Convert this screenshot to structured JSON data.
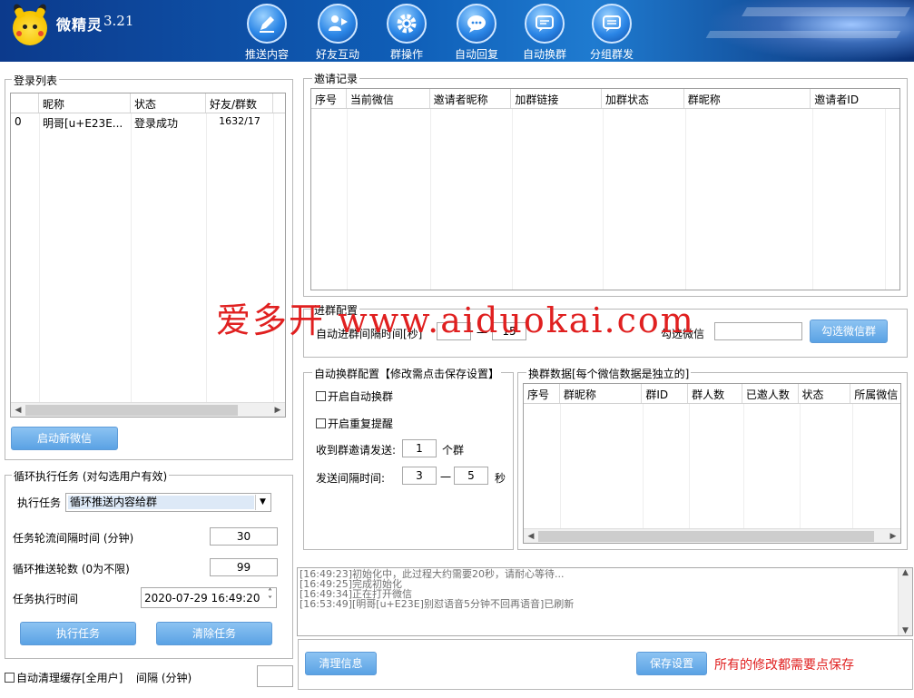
{
  "app": {
    "title": "微精灵",
    "version": "3.21"
  },
  "nav": [
    {
      "label": "推送内容",
      "icon": "pen-icon"
    },
    {
      "label": "好友互动",
      "icon": "user-play-icon"
    },
    {
      "label": "群操作",
      "icon": "gear-icon"
    },
    {
      "label": "自动回复",
      "icon": "chat-bubble-icon"
    },
    {
      "label": "自动换群",
      "icon": "chat-swap-icon"
    },
    {
      "label": "分组群发",
      "icon": "chat-group-icon"
    }
  ],
  "login": {
    "title": "登录列表",
    "columns": [
      "",
      "昵称",
      "状态",
      "好友/群数"
    ],
    "rows": [
      [
        "0",
        "明哥[u+E23E...",
        "登录成功",
        "1632/17"
      ]
    ],
    "start_button": "启动新微信"
  },
  "loop": {
    "title": "循环执行任务 (对勾选用户有效)",
    "task_label": "执行任务",
    "task_value": "循环推送内容给群",
    "interval_label": "任务轮流间隔时间 (分钟)",
    "interval_value": "30",
    "rounds_label": "循环推送轮数 (0为不限)",
    "rounds_value": "99",
    "time_label": "任务执行时间",
    "time_value": "2020-07-29 16:49:20",
    "run_button": "执行任务",
    "clear_button": "清除任务"
  },
  "autoclean": {
    "label": "自动清理缓存[全用户]",
    "interval_label": "间隔 (分钟)",
    "value": ""
  },
  "invite": {
    "title": "邀请记录",
    "columns": [
      "序号",
      "当前微信",
      "邀请者昵称",
      "加群链接",
      "加群状态",
      "群昵称",
      "邀请者ID"
    ]
  },
  "join": {
    "title": "进群配置",
    "interval_label": "自动进群间隔时间[秒]",
    "from": "",
    "dash": "一",
    "to": "15",
    "select_label": "勾选微信",
    "select_value": "",
    "select_button": "勾选微信群"
  },
  "autoswitch": {
    "title": "自动换群配置【修改需点击保存设置】",
    "enable_label": "开启自动换群",
    "repeat_label": "开启重复提醒",
    "recv_label": "收到群邀请发送:",
    "recv_value": "1",
    "recv_unit": "个群",
    "send_label": "发送间隔时间:",
    "send_from": "3",
    "send_dash": "一",
    "send_to": "5",
    "send_unit": "秒"
  },
  "groups": {
    "title": "换群数据[每个微信数据是独立的]",
    "columns": [
      "序号",
      "群昵称",
      "群ID",
      "群人数",
      "已邀人数",
      "状态",
      "所属微信"
    ]
  },
  "log": {
    "lines": [
      "[16:49:23]初始化中，此过程大约需要20秒，请耐心等待...",
      "[16:49:25]完成初始化",
      "[16:49:34]正在打开微信",
      "[16:53:49][明哥[u+E23E]别怼语音5分钟不回再语音]已刷新"
    ]
  },
  "footer": {
    "clear_button": "清理信息",
    "save_button": "保存设置",
    "notice": "所有的修改都需要点保存"
  },
  "watermark": {
    "text": "爱多开 www.aiduokai.com"
  },
  "colors": {
    "accent": "#5aa2e4",
    "banner": "#0f5fb8",
    "notice": "#e02020"
  }
}
